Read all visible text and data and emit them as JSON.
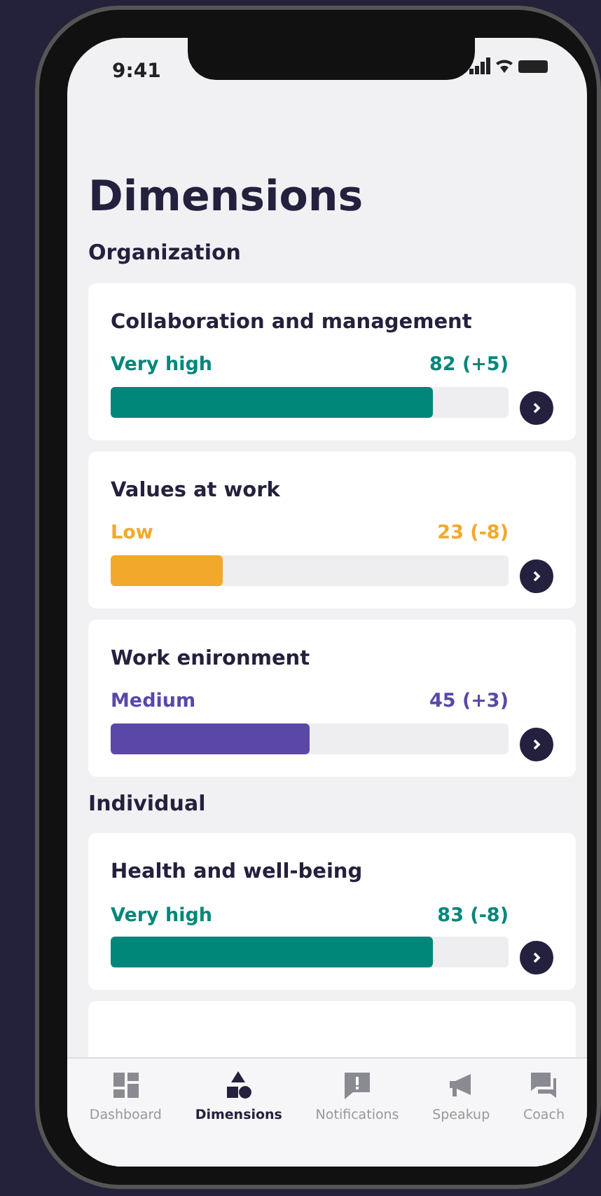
{
  "status_bar": {
    "time": "9:41"
  },
  "title": "Dimensions",
  "sections": [
    {
      "title": "Organization",
      "items": [
        {
          "name": "Collaboration and management",
          "rating": "Very high",
          "score": "82 (+5)",
          "level": 0.81,
          "color": "#00877a"
        },
        {
          "name": "Values at work",
          "rating": "Low",
          "score": "23 (-8)",
          "level": 0.28,
          "color": "#f2a92b"
        },
        {
          "name": "Work enironment",
          "rating": "Medium",
          "score": "45 (+3)",
          "level": 0.5,
          "color": "#5b47a8"
        }
      ]
    },
    {
      "title": "Individual",
      "items": [
        {
          "name": "Health and well-being",
          "rating": "Very high",
          "score": "83 (-8)",
          "level": 0.81,
          "color": "#00877a"
        }
      ]
    }
  ],
  "tabs": [
    {
      "label": "Dashboard",
      "selected": false
    },
    {
      "label": "Dimensions",
      "selected": true
    },
    {
      "label": "Notifications",
      "selected": false
    },
    {
      "label": "Speakup",
      "selected": false
    },
    {
      "label": "Coach",
      "selected": false
    }
  ]
}
